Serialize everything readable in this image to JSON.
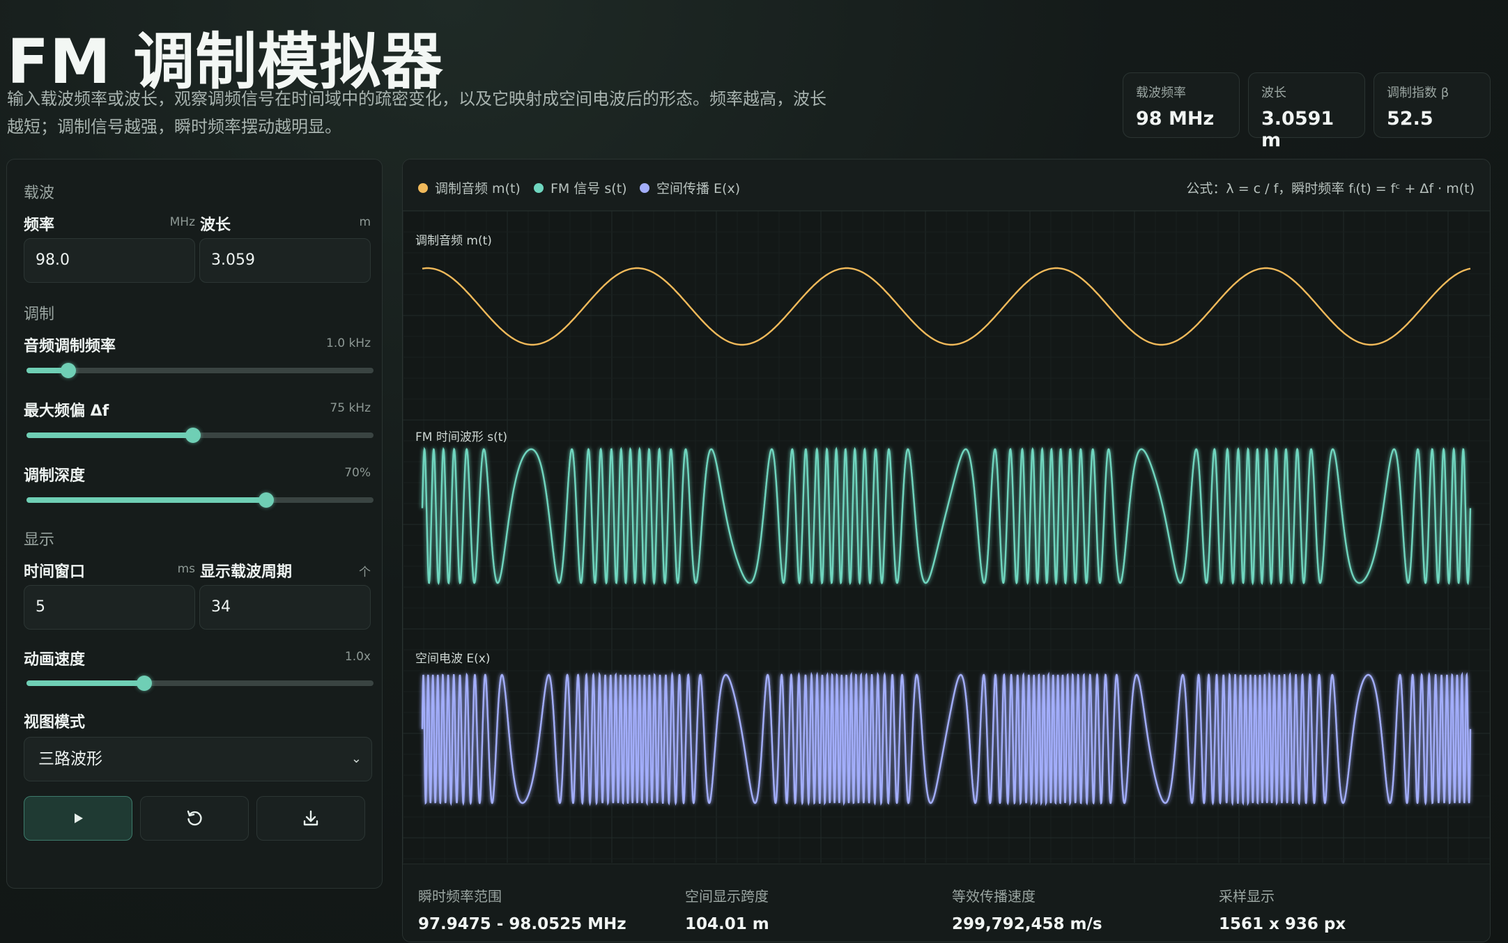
{
  "header": {
    "title": "FM 调制模拟器",
    "subtitle": "输入载波频率或波长，观察调频信号在时间域中的疏密变化，以及它映射成空间电波后的形态。频率越高，波长越短；调制信号越强，瞬时频率摆动越明显。"
  },
  "stats": [
    {
      "label": "载波频率",
      "value": "98 MHz"
    },
    {
      "label": "波长",
      "value": "3.0591 m"
    },
    {
      "label": "调制指数 β",
      "value": "52.5"
    }
  ],
  "controls": {
    "carrier": {
      "section": "载波",
      "freq_label": "频率",
      "freq_unit": "MHz",
      "freq_value": "98.0",
      "wl_label": "波长",
      "wl_unit": "m",
      "wl_value": "3.059"
    },
    "modulation": {
      "section": "调制",
      "audio": {
        "label": "音频调制频率",
        "value_text": "1.0 kHz",
        "fraction": 0.12
      },
      "dev": {
        "label": "最大频偏 Δf",
        "value_text": "75 kHz",
        "fraction": 0.48
      },
      "depth": {
        "label": "调制深度",
        "value_text": "70%",
        "fraction": 0.69
      }
    },
    "display": {
      "section": "显示",
      "window_label": "时间窗口",
      "window_unit": "ms",
      "window_value": "5",
      "cycles_label": "显示载波周期",
      "cycles_unit": "个",
      "cycles_value": "34",
      "speed": {
        "label": "动画速度",
        "value_text": "1.0x",
        "fraction": 0.34
      },
      "view_label": "视图模式",
      "view_value": "三路波形"
    },
    "buttons": {
      "play_icon": "play-icon",
      "reset_icon": "reset-icon",
      "download_icon": "download-icon"
    }
  },
  "viz": {
    "legend": [
      {
        "label": "调制音频 m(t)",
        "color": "#f0b95a"
      },
      {
        "label": "FM 信号 s(t)",
        "color": "#6fd6bf"
      },
      {
        "label": "空间传播 E(x)",
        "color": "#a3aefb"
      }
    ],
    "formula": "公式：λ = c / f，瞬时频率 fᵢ(t) = fᶜ + Δf · m(t)",
    "plots": [
      {
        "label": "调制音频 m(t)",
        "color": "#f0b95a"
      },
      {
        "label": "FM 时间波形 s(t)",
        "color": "#6fd6bf"
      },
      {
        "label": "空间电波 E(x)",
        "color": "#a3aefb"
      }
    ]
  },
  "footer": [
    {
      "label": "瞬时频率范围",
      "value": "97.9475 - 98.0525 MHz"
    },
    {
      "label": "空间显示跨度",
      "value": "104.01 m"
    },
    {
      "label": "等效传播速度",
      "value": "299,792,458 m/s"
    },
    {
      "label": "采样显示",
      "value": "1561 x 936 px"
    }
  ]
}
